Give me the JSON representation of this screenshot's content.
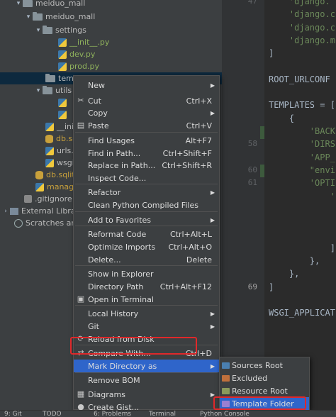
{
  "tree": {
    "items": [
      {
        "label": "meiduo_mall"
      },
      {
        "label": "meiduo_mall"
      },
      {
        "label": "settings"
      },
      {
        "label": "__init__.py"
      },
      {
        "label": "dev.py"
      },
      {
        "label": "prod.py"
      },
      {
        "label": "templates"
      },
      {
        "label": "utils"
      },
      {
        "label": "__init__"
      },
      {
        "label": "db.sq"
      },
      {
        "label": "urls.p"
      },
      {
        "label": "wsgi."
      },
      {
        "label": "db.sqlit"
      },
      {
        "label": "manage"
      },
      {
        "label": ".gitignore"
      },
      {
        "label": "External Librar"
      },
      {
        "label": "Scratches and"
      }
    ]
  },
  "editor": {
    "line_numbers": [
      "47",
      "",
      "",
      "",
      "",
      "",
      "",
      "",
      "",
      "",
      "",
      "58",
      "",
      "60",
      "61",
      "",
      "",
      "",
      "",
      "",
      "",
      "",
      "69",
      "",
      "",
      "",
      "",
      "",
      ""
    ],
    "lines": [
      "    'django.",
      "    'django.c",
      "    'django.c",
      "    'django.m",
      "]",
      "",
      "ROOT_URLCONF ",
      "",
      "TEMPLATES = [",
      "    {",
      "        'BACK",
      "        'DIRS",
      "        'APP_",
      "        \"envi",
      "        'OPTI",
      "            '",
      "",
      "",
      "",
      "            ]",
      "        },",
      "    },",
      "]",
      "",
      "WSGI_APPLICAT",
      "",
      "",
      "                   ",
      ""
    ]
  },
  "context_menu": {
    "items": [
      {
        "label": "New",
        "shortcut": "",
        "submenu": true,
        "icon": ""
      },
      {
        "label": "Cut",
        "shortcut": "Ctrl+X",
        "submenu": false,
        "icon": "scissors-icon"
      },
      {
        "label": "Copy",
        "shortcut": "",
        "submenu": true,
        "icon": ""
      },
      {
        "label": "Paste",
        "shortcut": "Ctrl+V",
        "submenu": false,
        "icon": "clipboard-icon"
      },
      {
        "label": "Find Usages",
        "shortcut": "Alt+F7",
        "submenu": false,
        "icon": ""
      },
      {
        "label": "Find in Path...",
        "shortcut": "Ctrl+Shift+F",
        "submenu": false,
        "icon": ""
      },
      {
        "label": "Replace in Path...",
        "shortcut": "Ctrl+Shift+R",
        "submenu": false,
        "icon": ""
      },
      {
        "label": "Inspect Code...",
        "shortcut": "",
        "submenu": false,
        "icon": ""
      },
      {
        "label": "Refactor",
        "shortcut": "",
        "submenu": true,
        "icon": ""
      },
      {
        "label": "Clean Python Compiled Files",
        "shortcut": "",
        "submenu": false,
        "icon": ""
      },
      {
        "label": "Add to Favorites",
        "shortcut": "",
        "submenu": true,
        "icon": ""
      },
      {
        "label": "Reformat Code",
        "shortcut": "Ctrl+Alt+L",
        "submenu": false,
        "icon": ""
      },
      {
        "label": "Optimize Imports",
        "shortcut": "Ctrl+Alt+O",
        "submenu": false,
        "icon": ""
      },
      {
        "label": "Delete...",
        "shortcut": "Delete",
        "submenu": false,
        "icon": ""
      },
      {
        "label": "Show in Explorer",
        "shortcut": "",
        "submenu": false,
        "icon": ""
      },
      {
        "label": "Directory Path",
        "shortcut": "Ctrl+Alt+F12",
        "submenu": false,
        "icon": ""
      },
      {
        "label": "Open in Terminal",
        "shortcut": "",
        "submenu": false,
        "icon": "terminal-icon"
      },
      {
        "label": "Local History",
        "shortcut": "",
        "submenu": true,
        "icon": ""
      },
      {
        "label": "Git",
        "shortcut": "",
        "submenu": true,
        "icon": ""
      },
      {
        "label": "Reload from Disk",
        "shortcut": "",
        "submenu": false,
        "icon": "reload-icon"
      },
      {
        "label": "Compare With...",
        "shortcut": "Ctrl+D",
        "submenu": false,
        "icon": "compare-icon"
      },
      {
        "label": "Mark Directory as",
        "shortcut": "",
        "submenu": true,
        "icon": ""
      },
      {
        "label": "Remove BOM",
        "shortcut": "",
        "submenu": false,
        "icon": ""
      },
      {
        "label": "Diagrams",
        "shortcut": "",
        "submenu": true,
        "icon": "diagram-icon"
      },
      {
        "label": "Create Gist...",
        "shortcut": "",
        "submenu": false,
        "icon": "github-icon"
      }
    ]
  },
  "submenu": {
    "items": [
      {
        "label": "Sources Root",
        "color": "#4a7fb0"
      },
      {
        "label": "Excluded",
        "color": "#c0703c"
      },
      {
        "label": "Resource Root",
        "color": "#8a9a5b"
      },
      {
        "label": "Template Folder",
        "color": "#9a7fd1"
      }
    ]
  },
  "statusbar": {
    "items": [
      "9: Git",
      "TODO",
      "6: Problems",
      "Terminal",
      "Python Console"
    ]
  },
  "colors": {
    "highlight_border": "#e0282a",
    "menu_selection": "#2f65ca"
  }
}
